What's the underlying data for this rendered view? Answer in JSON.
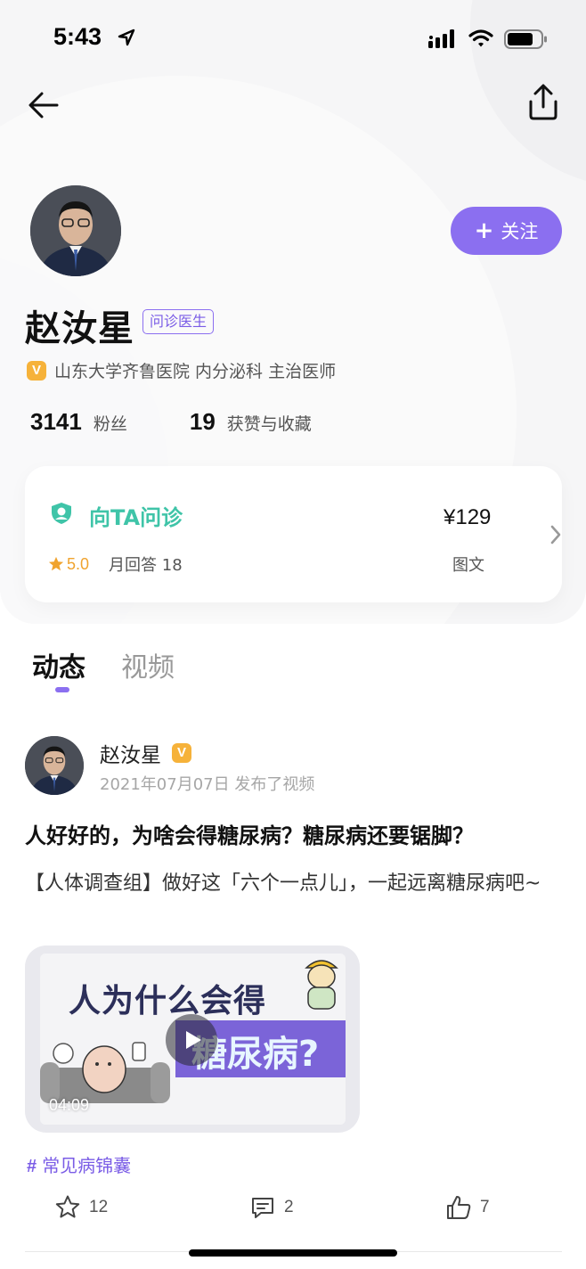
{
  "status_bar": {
    "time": "5:43"
  },
  "icons": {
    "back": "arrow-left-icon",
    "share": "share-icon",
    "verified": "verified-v-icon",
    "consult": "doctor-consult-icon",
    "star": "star-icon",
    "chevron": "chevron-right-icon",
    "play": "play-icon",
    "favorite": "star-outline-icon",
    "comment": "comment-icon",
    "like": "thumbs-up-icon"
  },
  "colors": {
    "accent": "#8b6ff0",
    "consult_green": "#3fc4a8",
    "rating_orange": "#f0a32e",
    "verified_yellow": "#f6b23a"
  },
  "profile": {
    "follow_label": "关注",
    "name": "赵汝星",
    "tag": "问诊医生",
    "verified_mark": "V",
    "hospital": "山东大学齐鲁医院 内分泌科 主治医师",
    "fans_count": "3141",
    "fans_label": "粉丝",
    "likes_count": "19",
    "likes_label": "获赞与收藏"
  },
  "consult": {
    "title": "向TA问诊",
    "rating": "5.0",
    "monthly_answers": "月回答 18",
    "price": "¥129",
    "type": "图文"
  },
  "tabs": [
    {
      "label": "动态",
      "active": true
    },
    {
      "label": "视频",
      "active": false
    }
  ],
  "post": {
    "author": "赵汝星",
    "meta": "2021年07月07日 发布了视频",
    "title": "人好好的，为啥会得糖尿病？糖尿病还要锯脚？",
    "description": "【人体调查组】做好这「六个一点儿」，一起远离糖尿病吧~",
    "video": {
      "thumb_line1": "人为什么会得",
      "thumb_line2": "糖尿病?",
      "duration": "04:09"
    },
    "topic": "常见病锦囊",
    "topic_hash": "#",
    "favorites": "12",
    "comments": "2",
    "likes": "7"
  }
}
